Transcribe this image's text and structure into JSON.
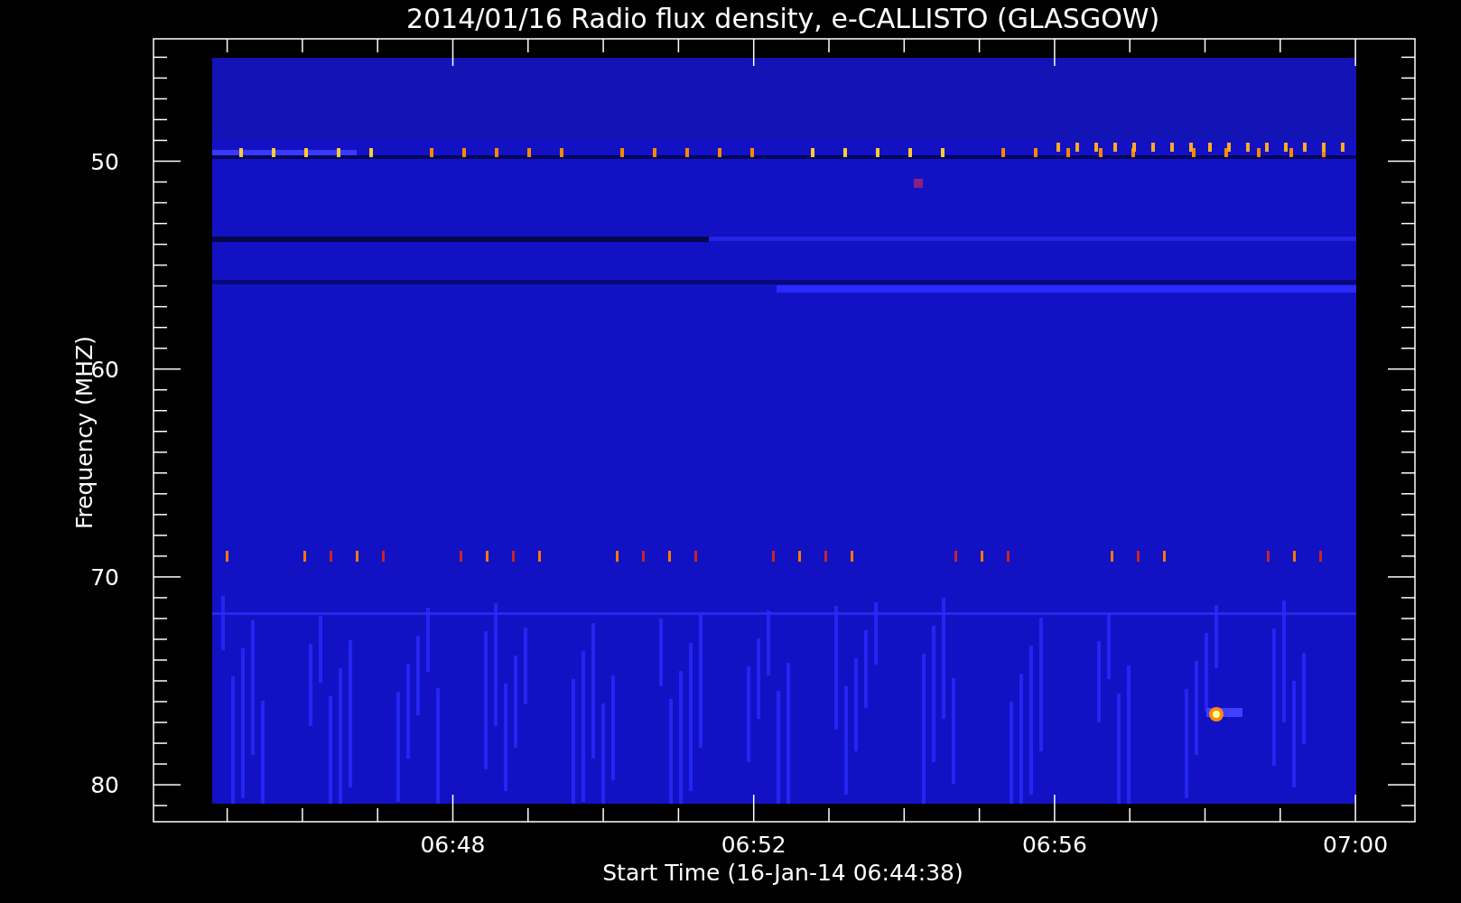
{
  "plot": {
    "title": "2014/01/16  Radio flux density, e-CALLISTO (GLASGOW)",
    "ylabel": "Frequency (MHZ)",
    "xlabel": "Start Time (16-Jan-14 06:44:38)",
    "ytick_labels": [
      "50",
      "60",
      "70",
      "80"
    ],
    "xtick_labels": [
      "06:48",
      "06:52",
      "06:56",
      "07:00"
    ]
  }
}
